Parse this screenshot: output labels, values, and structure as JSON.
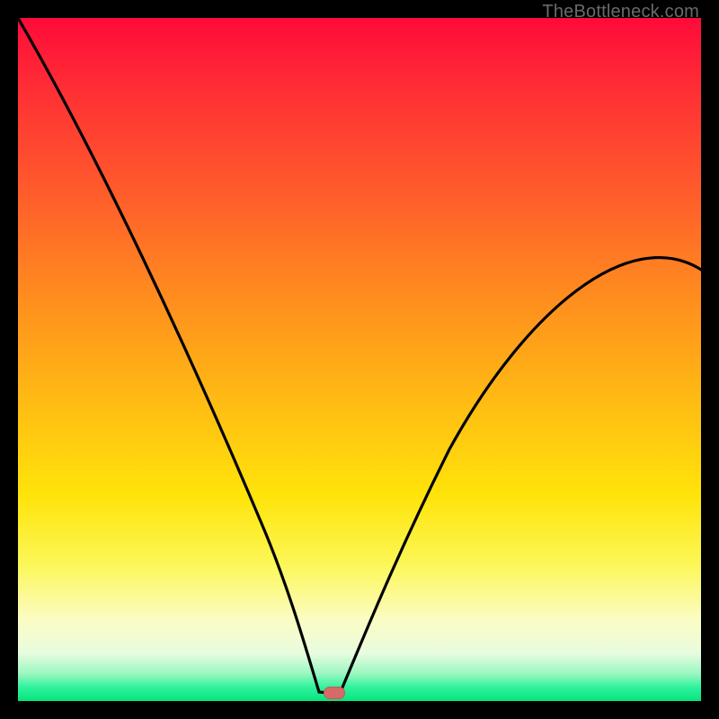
{
  "watermark": "TheBottleneck.com",
  "chart_data": {
    "type": "line",
    "title": "",
    "xlabel": "",
    "ylabel": "",
    "xlim": [
      0,
      100
    ],
    "ylim": [
      0,
      100
    ],
    "grid": false,
    "legend": false,
    "background_gradient": [
      "#ff0a3a",
      "#ff8a1f",
      "#ffe40a",
      "#fbfcc2",
      "#05e47d"
    ],
    "series": [
      {
        "name": "left-branch",
        "x": [
          0,
          5,
          10,
          15,
          20,
          25,
          30,
          35,
          38,
          40,
          42,
          44,
          45,
          46
        ],
        "values": [
          100,
          90,
          79,
          68,
          57,
          46,
          34,
          22,
          14,
          8,
          4,
          1,
          0,
          0
        ]
      },
      {
        "name": "right-branch",
        "x": [
          46,
          48,
          50,
          55,
          60,
          65,
          70,
          75,
          80,
          85,
          90,
          95,
          100
        ],
        "values": [
          0,
          2,
          7,
          18,
          27,
          34,
          40,
          45,
          50,
          54,
          57,
          60,
          63
        ]
      }
    ],
    "annotations": [
      {
        "name": "min-marker",
        "x": 46,
        "y": 0,
        "shape": "rounded-rect",
        "color": "#d66a64"
      }
    ]
  }
}
